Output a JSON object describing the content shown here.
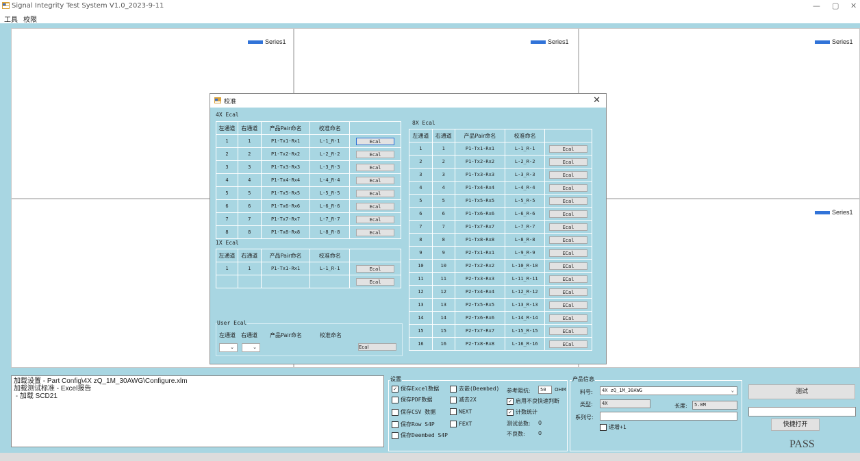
{
  "window": {
    "title": "Signal Integrity Test System V1.0_2023-9-11",
    "minimize": "—",
    "maximize": "▢",
    "close": "✕"
  },
  "menu": [
    "工具",
    "校限"
  ],
  "charts": {
    "legend": "Series1"
  },
  "log_lines": [
    "加载设置 - Part Config\\4X zQ_1M_30AWG\\Configure.xlm",
    "加载测试标准 - Excel报告",
    " - 加载 SCD21"
  ],
  "settings": {
    "title": "设置",
    "col1": [
      {
        "label": "保存Excel数据",
        "checked": true
      },
      {
        "label": "保存PDF数据",
        "checked": false
      },
      {
        "label": "保存CSV 数据",
        "checked": false
      },
      {
        "label": "保存Row S4P",
        "checked": false
      },
      {
        "label": "保存Deembed S4P",
        "checked": false
      }
    ],
    "col2": [
      {
        "label": "去嵌(Deembed)",
        "checked": false
      },
      {
        "label": "减去2X",
        "checked": false
      },
      {
        "label": "NEXT",
        "checked": false
      },
      {
        "label": "FEXT",
        "checked": false
      }
    ],
    "ref_impedance_label": "参考阻抗:",
    "ref_impedance_value": "50",
    "ref_impedance_unit": "OHM",
    "col3": [
      {
        "label": "启用不良快速判断",
        "checked": true
      },
      {
        "label": "计数统计",
        "checked": true
      }
    ],
    "total_label": "测试总数:",
    "total_value": "0",
    "fail_label": "不良数:",
    "fail_value": "0"
  },
  "product": {
    "title": "产品信息",
    "part_label": "料号:",
    "part_value": "4X zQ_1M_30AWG",
    "type_label": "类型:",
    "type_value": "4X",
    "length_label": "长度:",
    "length_value": "5.0M",
    "serial_label": "系列号:",
    "serial_value": "",
    "increment_label": "递增+1",
    "increment_checked": false
  },
  "actions": {
    "test": "测试",
    "open": "快捷打开",
    "result_input": "",
    "pass": "PASS"
  },
  "dialog": {
    "title": "校准",
    "close": "✕",
    "headers": {
      "left": "左通道",
      "right": "右通道",
      "pair": "产品Pair命名",
      "cal": "校准命名"
    },
    "sec4x": "4X Ecal",
    "rows4x": [
      {
        "l": "1",
        "r": "1",
        "pair": "P1-Tx1-Rx1",
        "cal": "L-1_R-1",
        "btn": "Ecal"
      },
      {
        "l": "2",
        "r": "2",
        "pair": "P1-Tx2-Rx2",
        "cal": "L-2_R-2",
        "btn": "Ecal"
      },
      {
        "l": "3",
        "r": "3",
        "pair": "P1-Tx3-Rx3",
        "cal": "L-3_R-3",
        "btn": "Ecal"
      },
      {
        "l": "4",
        "r": "4",
        "pair": "P1-Tx4-Rx4",
        "cal": "L-4_R-4",
        "btn": "Ecal"
      },
      {
        "l": "5",
        "r": "5",
        "pair": "P1-Tx5-Rx5",
        "cal": "L-5_R-5",
        "btn": "Ecal"
      },
      {
        "l": "6",
        "r": "6",
        "pair": "P1-Tx6-Rx6",
        "cal": "L-6_R-6",
        "btn": "Ecal"
      },
      {
        "l": "7",
        "r": "7",
        "pair": "P1-Tx7-Rx7",
        "cal": "L-7_R-7",
        "btn": "Ecal"
      },
      {
        "l": "8",
        "r": "8",
        "pair": "P1-Tx8-Rx8",
        "cal": "L-8_R-8",
        "btn": "Ecal"
      }
    ],
    "sec1x": "1X Ecal",
    "rows1x": [
      {
        "l": "1",
        "r": "1",
        "pair": "P1-Tx1-Rx1",
        "cal": "L-1_R-1",
        "btn": "Ecal"
      },
      {
        "l": "",
        "r": "",
        "pair": "",
        "cal": "",
        "btn": "Ecal"
      }
    ],
    "secuser": "User Ecal",
    "user_btn": "Ecal",
    "sec8x": "8X Ecal",
    "rows8x": [
      {
        "l": "1",
        "r": "1",
        "pair": "P1-Tx1-Rx1",
        "cal": "L-1_R-1",
        "btn": "Ecal"
      },
      {
        "l": "2",
        "r": "2",
        "pair": "P1-Tx2-Rx2",
        "cal": "L-2_R-2",
        "btn": "Ecal"
      },
      {
        "l": "3",
        "r": "3",
        "pair": "P1-Tx3-Rx3",
        "cal": "L-3_R-3",
        "btn": "Ecal"
      },
      {
        "l": "4",
        "r": "4",
        "pair": "P1-Tx4-Rx4",
        "cal": "L-4_R-4",
        "btn": "Ecal"
      },
      {
        "l": "5",
        "r": "5",
        "pair": "P1-Tx5-Rx5",
        "cal": "L-5_R-5",
        "btn": "Ecal"
      },
      {
        "l": "6",
        "r": "6",
        "pair": "P1-Tx6-Rx6",
        "cal": "L-6_R-6",
        "btn": "Ecal"
      },
      {
        "l": "7",
        "r": "7",
        "pair": "P1-Tx7-Rx7",
        "cal": "L-7_R-7",
        "btn": "Ecal"
      },
      {
        "l": "8",
        "r": "8",
        "pair": "P1-Tx8-Rx8",
        "cal": "L-8_R-8",
        "btn": "Ecal"
      },
      {
        "l": "9",
        "r": "9",
        "pair": "P2-Tx1-Rx1",
        "cal": "L-9_R-9",
        "btn": "ECal"
      },
      {
        "l": "10",
        "r": "10",
        "pair": "P2-Tx2-Rx2",
        "cal": "L-10_R-10",
        "btn": "ECal"
      },
      {
        "l": "11",
        "r": "11",
        "pair": "P2-Tx3-Rx3",
        "cal": "L-11_R-11",
        "btn": "ECal"
      },
      {
        "l": "12",
        "r": "12",
        "pair": "P2-Tx4-Rx4",
        "cal": "L-12_R-12",
        "btn": "ECal"
      },
      {
        "l": "13",
        "r": "13",
        "pair": "P2-Tx5-Rx5",
        "cal": "L-13_R-13",
        "btn": "ECal"
      },
      {
        "l": "14",
        "r": "14",
        "pair": "P2-Tx6-Rx6",
        "cal": "L-14_R-14",
        "btn": "ECal"
      },
      {
        "l": "15",
        "r": "15",
        "pair": "P2-Tx7-Rx7",
        "cal": "L-15_R-15",
        "btn": "ECal"
      },
      {
        "l": "16",
        "r": "16",
        "pair": "P2-Tx8-Rx8",
        "cal": "L-16_R-16",
        "btn": "ECal"
      }
    ]
  }
}
